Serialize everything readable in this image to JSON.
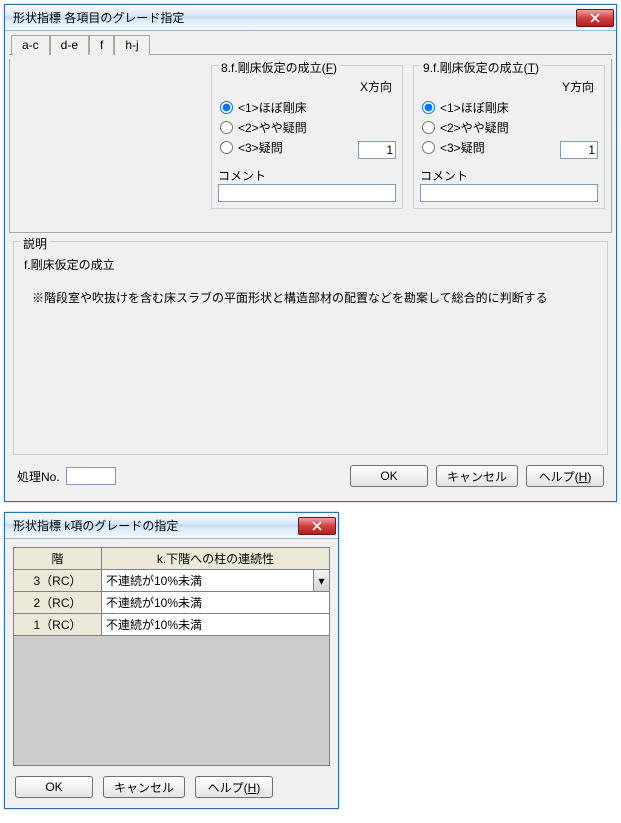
{
  "dialog1": {
    "title": "形状指標 各項目のグレード指定",
    "tabs": [
      "a-c",
      "d-e",
      "f",
      "h-j"
    ],
    "active_tab": 2,
    "group8": {
      "legend_a": "8.f.剛床仮定の成立(",
      "legend_u": "F",
      "legend_b": ")",
      "dir": "X方向",
      "radios": [
        "<1>ほぼ剛床",
        "<2>やや疑問",
        "<3>疑問"
      ],
      "selected": 0,
      "value": "1",
      "comment_label": "コメント",
      "comment_value": ""
    },
    "group9": {
      "legend_a": "9.f.剛床仮定の成立(",
      "legend_u": "T",
      "legend_b": ")",
      "dir": "Y方向",
      "radios": [
        "<1>ほぼ剛床",
        "<2>やや疑問",
        "<3>疑問"
      ],
      "selected": 0,
      "value": "1",
      "comment_label": "コメント",
      "comment_value": ""
    },
    "desc": {
      "legend": "説明",
      "title": "f.剛床仮定の成立",
      "body": "※階段室や吹抜けを含む床スラブの平面形状と構造部材の配置などを勘案して総合的に判断する"
    },
    "proc_label": "処理No.",
    "proc_value": "",
    "buttons": {
      "ok": "OK",
      "cancel": "キャンセル",
      "help_a": "ヘルプ(",
      "help_u": "H",
      "help_b": ")"
    }
  },
  "dialog2": {
    "title": "形状指標 k項のグレードの指定",
    "col1": "階",
    "col2": "k.下階への柱の連続性",
    "rows": [
      {
        "label": "3（RC）",
        "value": "不連続が10%未満",
        "dropdown": true
      },
      {
        "label": "2（RC）",
        "value": "不連続が10%未満",
        "dropdown": false
      },
      {
        "label": "1（RC）",
        "value": "不連続が10%未満",
        "dropdown": false
      }
    ],
    "buttons": {
      "ok": "OK",
      "cancel": "キャンセル",
      "help_a": "ヘルプ(",
      "help_u": "H",
      "help_b": ")"
    }
  }
}
